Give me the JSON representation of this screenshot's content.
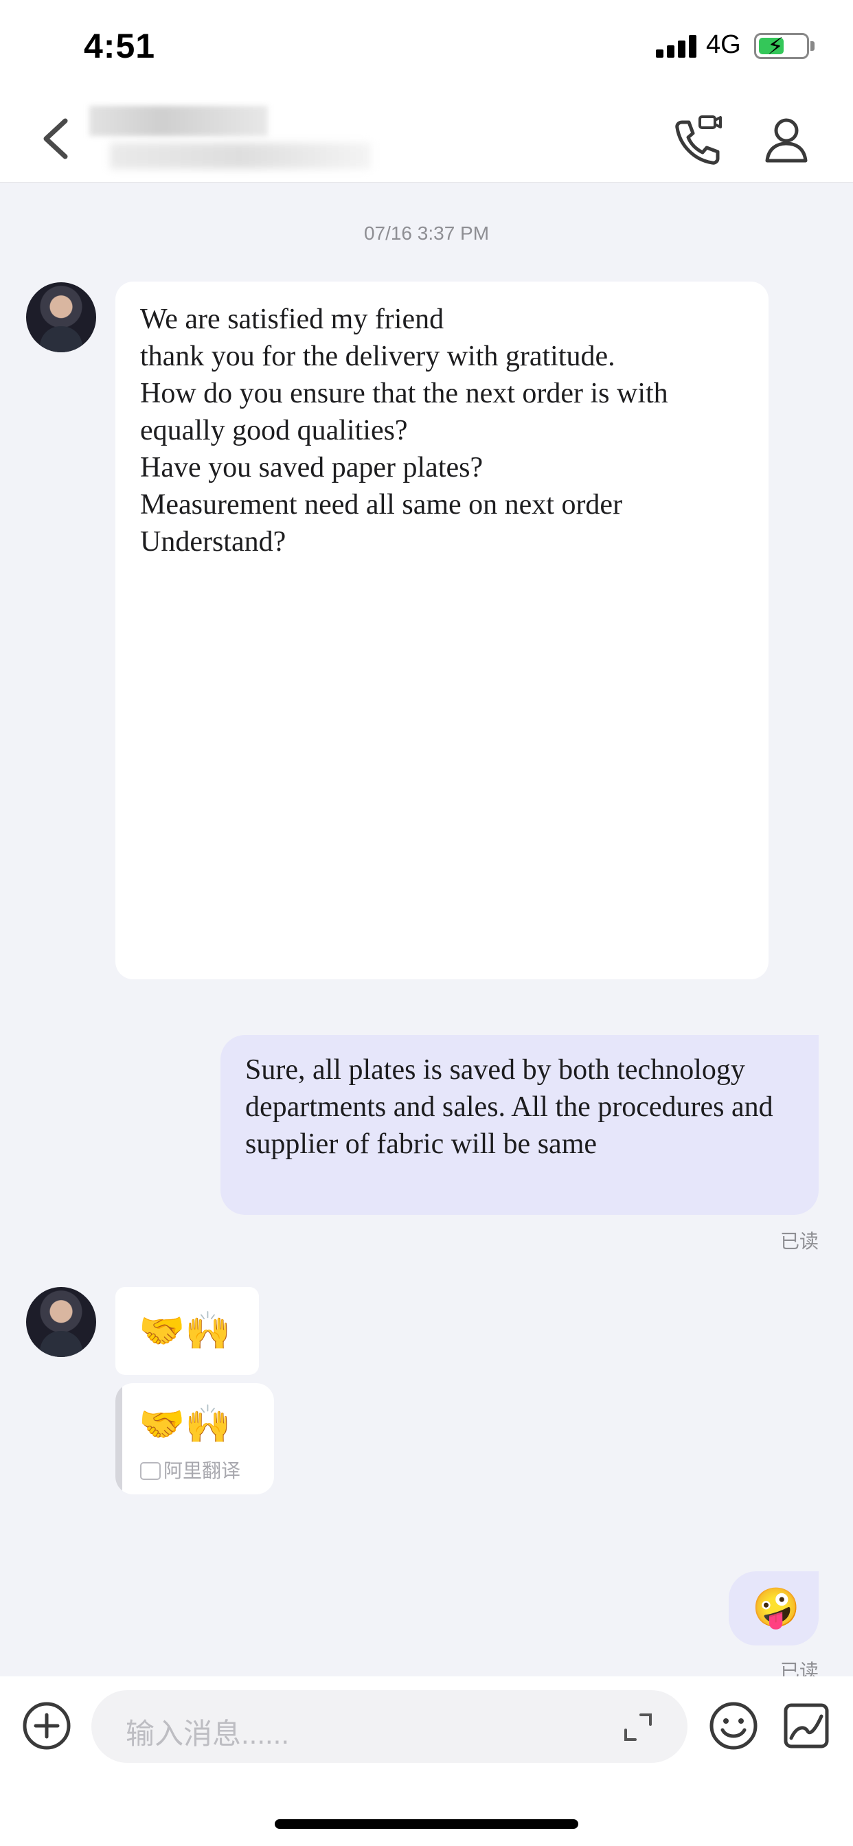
{
  "status_bar": {
    "time": "4:51",
    "network": "4G",
    "battery_level": 0.55
  },
  "header": {
    "back_icon": "chevron-left-icon",
    "call_icon": "video-call-icon",
    "profile_icon": "person-icon"
  },
  "chat": {
    "timestamp": "07/16 3:37 PM",
    "messages": [
      {
        "direction": "incoming",
        "lines": [
          "We are satisfied my friend",
          "",
          "thank you for the delivery with gratitude.",
          "",
          "",
          "",
          "How do you ensure that the next order is with equally good qualities?",
          "",
          "Have you saved paper plates?",
          "",
          "",
          "",
          "Measurement need all same on next order",
          "",
          "",
          "",
          "Understand?"
        ]
      },
      {
        "direction": "outgoing",
        "text": "Sure, all plates is saved by both technology departments and sales. All the procedures and supplier of fabric will be same",
        "read_status": "已读"
      },
      {
        "direction": "incoming",
        "text": "🤝🙌",
        "translation": "🤝🙌",
        "translation_label": "阿里翻译"
      },
      {
        "direction": "outgoing",
        "text": "🤪",
        "read_status": "已读"
      }
    ]
  },
  "input_bar": {
    "placeholder": "输入消息......",
    "add_icon": "plus-circle-icon",
    "expand_icon": "expand-icon",
    "emoji_icon": "smiley-icon",
    "sticker_icon": "sticker-icon"
  },
  "colors": {
    "chat_background": "#f2f3f8",
    "outgoing_bubble": "#e6e6fa",
    "incoming_bubble": "#ffffff",
    "meta_text": "#8e8e93"
  }
}
